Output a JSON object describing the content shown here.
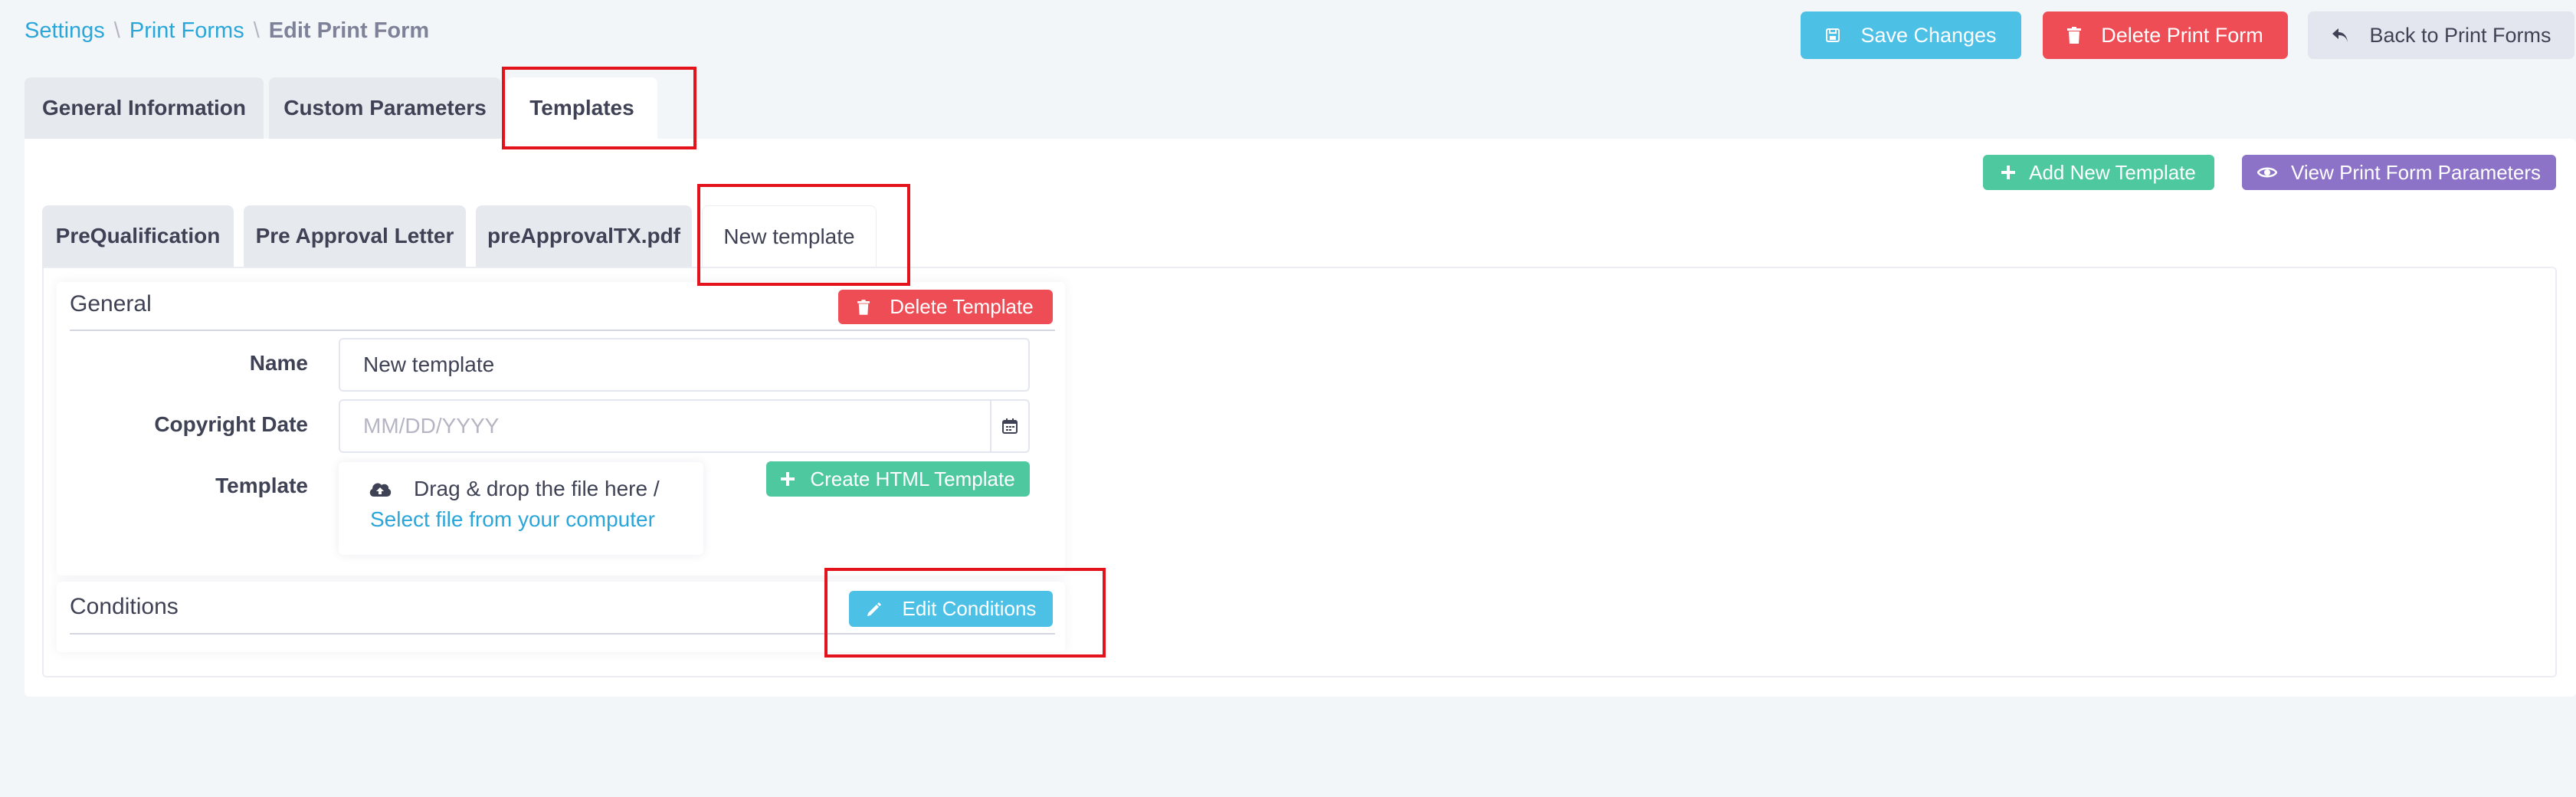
{
  "breadcrumb": {
    "items": [
      "Settings",
      "Print Forms"
    ],
    "separator": "\\",
    "current": "Edit Print Form"
  },
  "toolbar": {
    "save_label": "Save Changes",
    "delete_label": "Delete Print Form",
    "back_label": "Back to Print Forms"
  },
  "main_tabs": [
    {
      "label": "General Information",
      "active": false
    },
    {
      "label": "Custom Parameters",
      "active": false
    },
    {
      "label": "Templates",
      "active": true
    }
  ],
  "templates_panel": {
    "add_template_label": "Add New Template",
    "view_params_label": "View Print Form Parameters",
    "template_tabs": [
      {
        "label": "PreQualification",
        "active": false
      },
      {
        "label": "Pre Approval Letter",
        "active": false
      },
      {
        "label": "preApprovalTX.pdf",
        "active": false
      },
      {
        "label": "New template",
        "active": true
      }
    ]
  },
  "general_section": {
    "title": "General",
    "delete_template_label": "Delete Template",
    "name_label": "Name",
    "name_value": "New template",
    "copyright_label": "Copyright Date",
    "copyright_placeholder": "MM/DD/YYYY",
    "template_label": "Template",
    "dropzone_text": "Drag & drop the file here /",
    "dropzone_link": "Select file from your computer",
    "create_html_label": "Create HTML Template"
  },
  "conditions_section": {
    "title": "Conditions",
    "edit_conditions_label": "Edit Conditions"
  },
  "colors": {
    "info": "#4dc0e6",
    "danger": "#ef4d56",
    "success": "#4ec89e",
    "purple": "#8c73c8",
    "highlight": "#e3121b",
    "link": "#2aa6d9"
  },
  "icons": {
    "save": "floppy-disk-icon",
    "delete": "trash-icon",
    "back": "reply-arrow-icon",
    "add": "plus-icon",
    "view": "eye-icon",
    "calendar": "calendar-icon",
    "upload": "cloud-upload-icon",
    "edit": "pencil-icon"
  }
}
